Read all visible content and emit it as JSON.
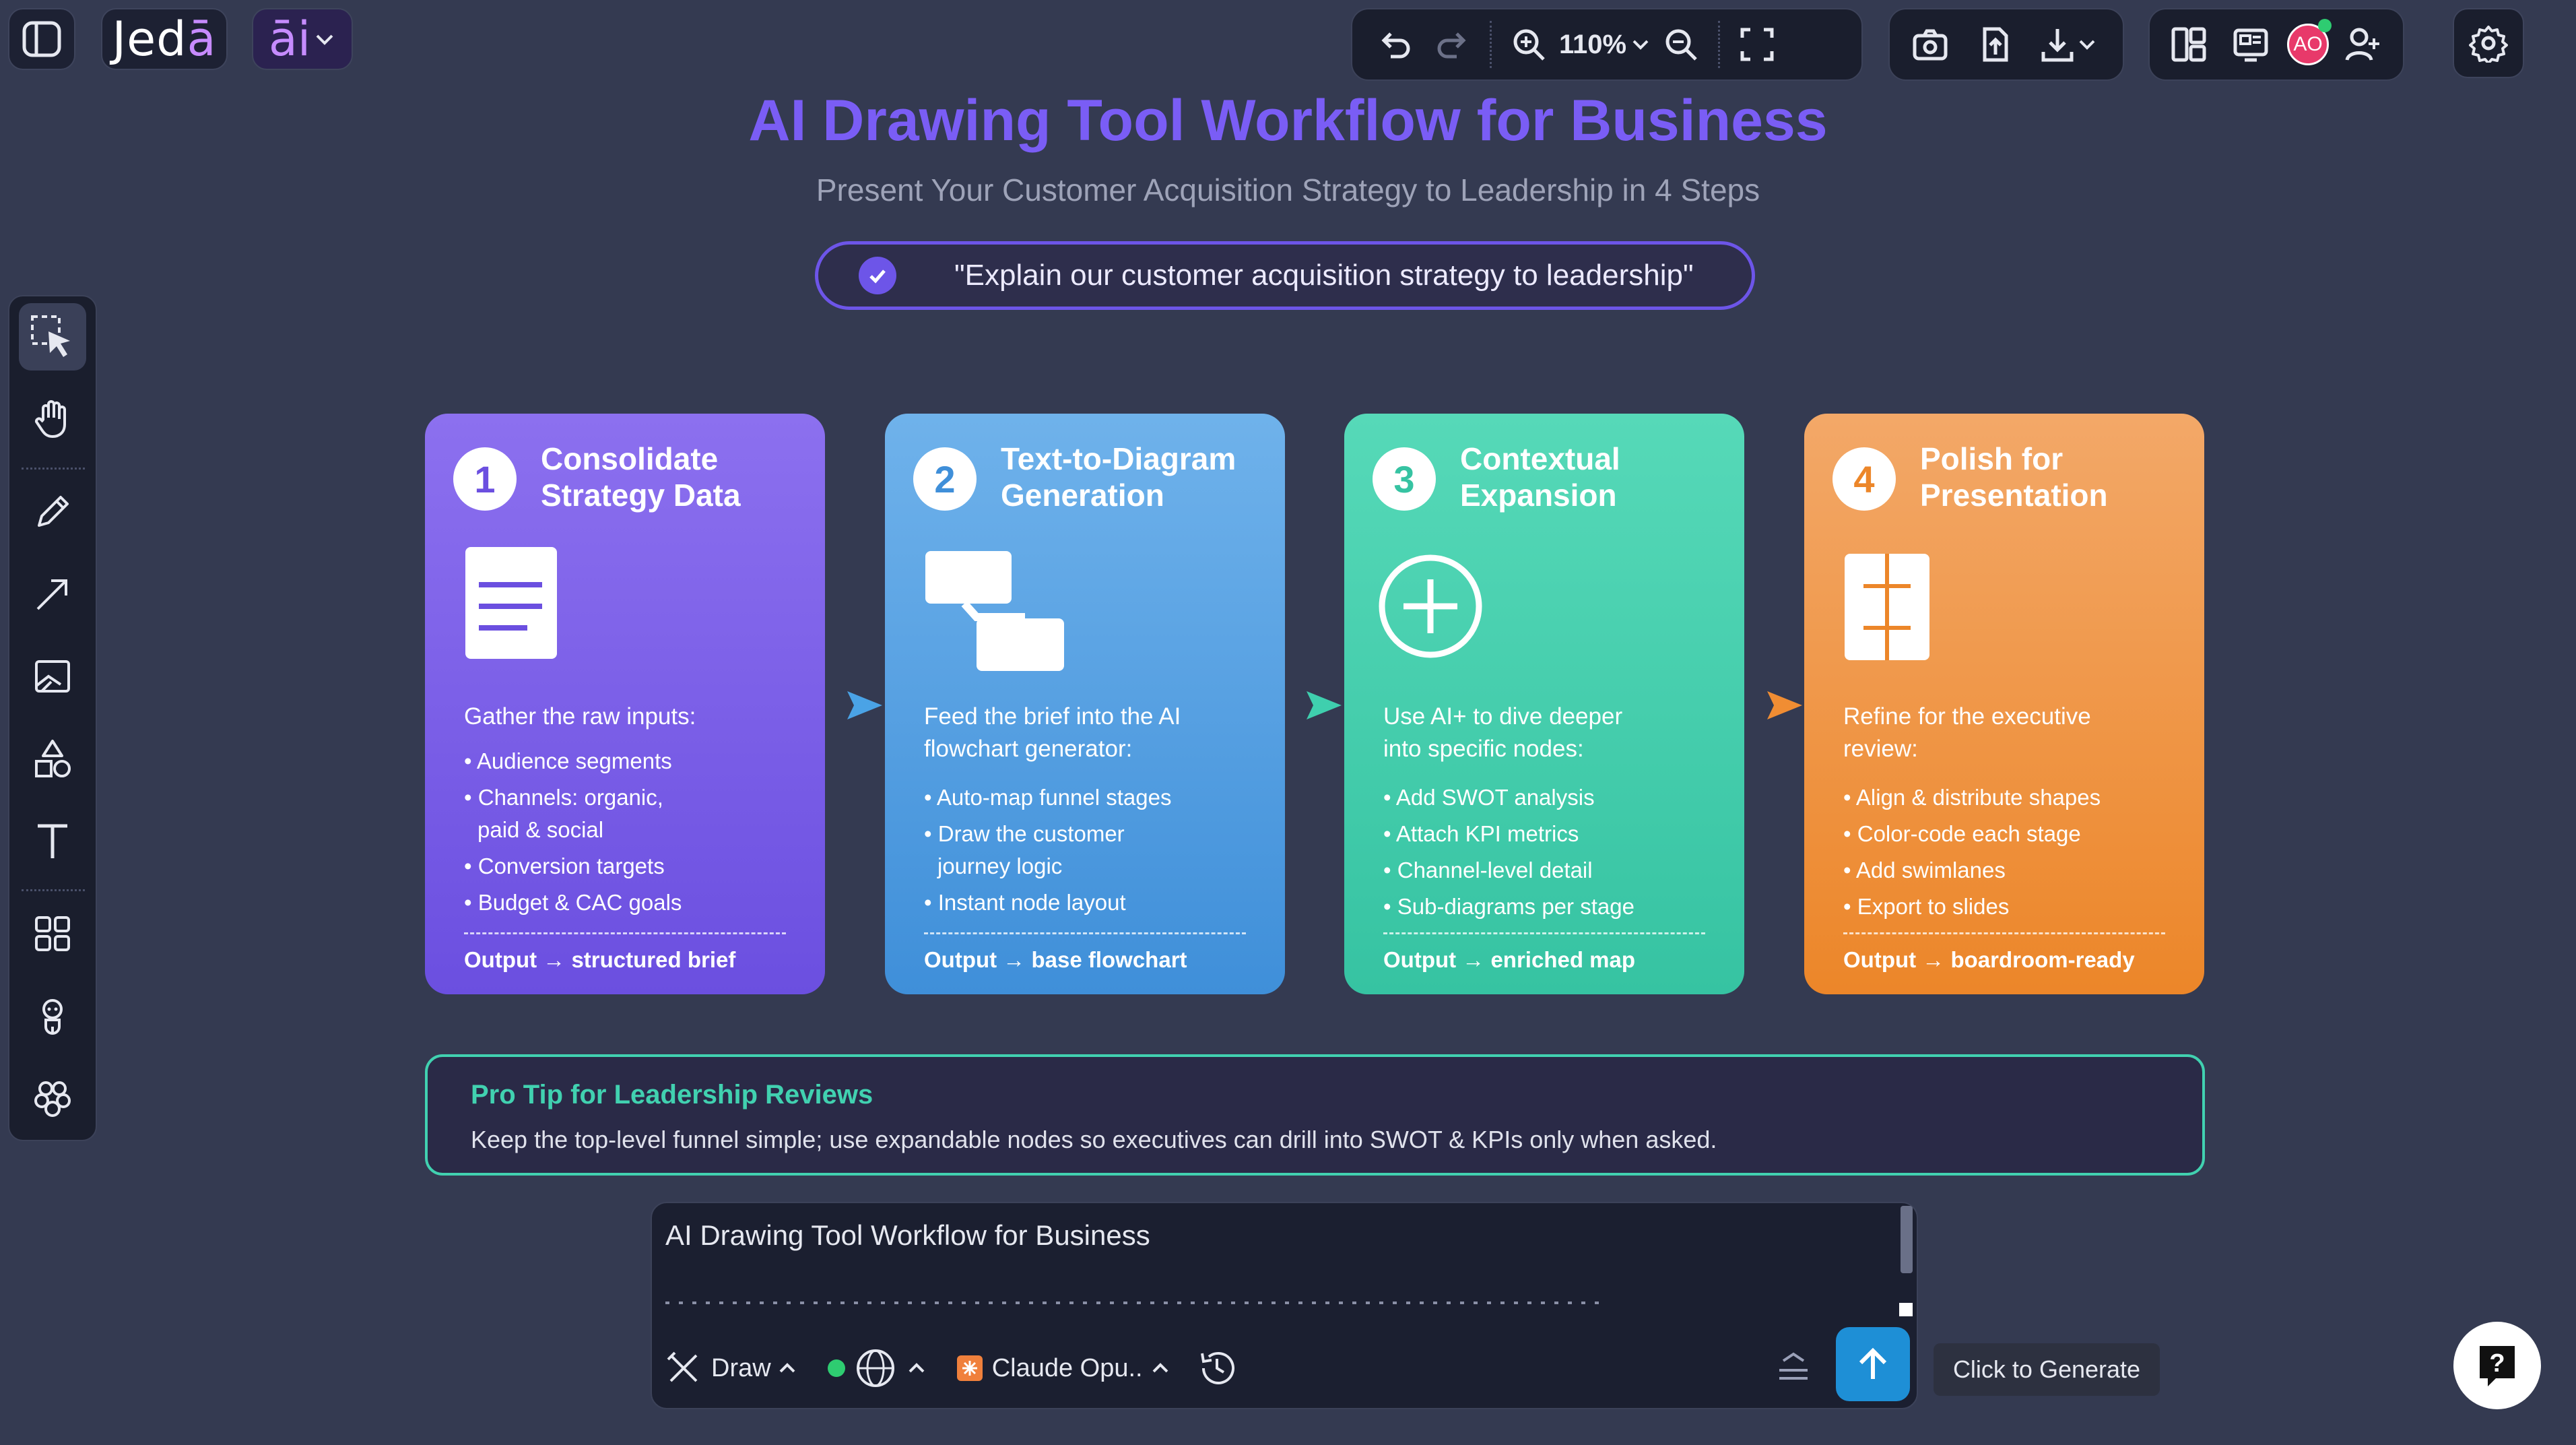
{
  "app": {
    "logo_text_a": "Jed",
    "logo_text_b": "ā",
    "ai_label": "āi"
  },
  "toolbar": {
    "zoom": "110%"
  },
  "header": {
    "title": "AI Drawing Tool Workflow for Business",
    "subtitle": "Present Your Customer Acquisition Strategy to Leadership in 4 Steps",
    "prompt": "\"Explain our customer acquisition strategy to leadership\""
  },
  "steps": [
    {
      "number": "1",
      "title": "Consolidate Strategy Data",
      "lead": "Gather the raw inputs:",
      "items": [
        "Audience segments",
        "Channels: organic, paid & social",
        "Conversion targets",
        "Budget & CAC goals"
      ],
      "output": "Output → structured brief",
      "icon": "document-icon"
    },
    {
      "number": "2",
      "title": "Text-to-Diagram Generation",
      "lead": "Feed the brief into the AI flowchart generator:",
      "items": [
        "Auto-map funnel stages",
        "Draw the customer journey logic",
        "Instant node layout"
      ],
      "output": "Output → base flowchart",
      "icon": "flowchart-icon"
    },
    {
      "number": "3",
      "title": "Contextual Expansion",
      "lead": "Use AI+ to dive deeper into specific nodes:",
      "items": [
        "Add SWOT analysis",
        "Attach KPI metrics",
        "Channel-level detail",
        "Sub-diagrams per stage"
      ],
      "output": "Output → enriched map",
      "icon": "plus-circle-icon"
    },
    {
      "number": "4",
      "title": "Polish for Presentation",
      "lead": "Refine for the executive review:",
      "items": [
        "Align & distribute shapes",
        "Color-code each stage",
        "Add swimlanes",
        "Export to slides"
      ],
      "output": "Output → boardroom-ready",
      "icon": "layout-icon"
    }
  ],
  "protip": {
    "title": "Pro Tip for Leadership Reviews",
    "text": "Keep the top-level funnel simple; use expandable nodes so executives can drill into SWOT & KPIs only when asked."
  },
  "composer": {
    "text": "AI Drawing Tool Workflow for Business",
    "mode_label": "Draw",
    "model_label": "Claude Opu..",
    "tooltip": "Click to Generate"
  },
  "user": {
    "initials": "AO"
  },
  "colors": {
    "background": "#343a51",
    "title": "#7a5df5",
    "step1": "#6b4fe0",
    "step2": "#3f8fd9",
    "step3": "#36c3a2",
    "step4": "#ec8629",
    "protip_border": "#41d1b0",
    "send": "#1e8fd6"
  }
}
